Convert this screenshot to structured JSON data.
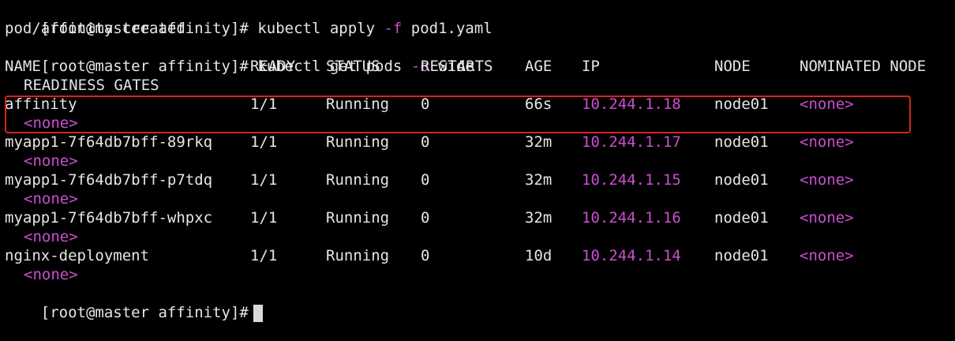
{
  "prompt_prefix": "[root@master affinity]# ",
  "commands": [
    {
      "parts": [
        "kubectl apply ",
        "-f",
        " pod1.yaml"
      ]
    },
    {
      "output": "pod/affinity created"
    },
    {
      "parts": [
        "kubectl get pods ",
        "-o",
        " wide"
      ]
    }
  ],
  "headers": [
    "NAME",
    "READY",
    "STATUS",
    "RESTARTS",
    "AGE",
    "IP",
    "NODE",
    "NOMINATED NODE",
    "READINESS GATES"
  ],
  "pods": [
    {
      "name": "affinity",
      "ready": "1/1",
      "status": "Running",
      "restarts": "0",
      "age": "66s",
      "ip": "10.244.1.18",
      "node": "node01",
      "nominated": "<none>",
      "gates": "<none>"
    },
    {
      "name": "myapp1-7f64db7bff-89rkq",
      "ready": "1/1",
      "status": "Running",
      "restarts": "0",
      "age": "32m",
      "ip": "10.244.1.17",
      "node": "node01",
      "nominated": "<none>",
      "gates": "<none>"
    },
    {
      "name": "myapp1-7f64db7bff-p7tdq",
      "ready": "1/1",
      "status": "Running",
      "restarts": "0",
      "age": "32m",
      "ip": "10.244.1.15",
      "node": "node01",
      "nominated": "<none>",
      "gates": "<none>"
    },
    {
      "name": "myapp1-7f64db7bff-whpxc",
      "ready": "1/1",
      "status": "Running",
      "restarts": "0",
      "age": "32m",
      "ip": "10.244.1.16",
      "node": "node01",
      "nominated": "<none>",
      "gates": "<none>"
    },
    {
      "name": "nginx-deployment",
      "ready": "1/1",
      "status": "Running",
      "restarts": "0",
      "age": "10d",
      "ip": "10.244.1.14",
      "node": "node01",
      "nominated": "<none>",
      "gates": "<none>"
    }
  ],
  "final_prompt": "[root@master affinity]#",
  "colors": {
    "accent": "#c94fd0",
    "highlight_box": "#d0281e",
    "background": "#000000",
    "text": "#e6e6e6"
  }
}
